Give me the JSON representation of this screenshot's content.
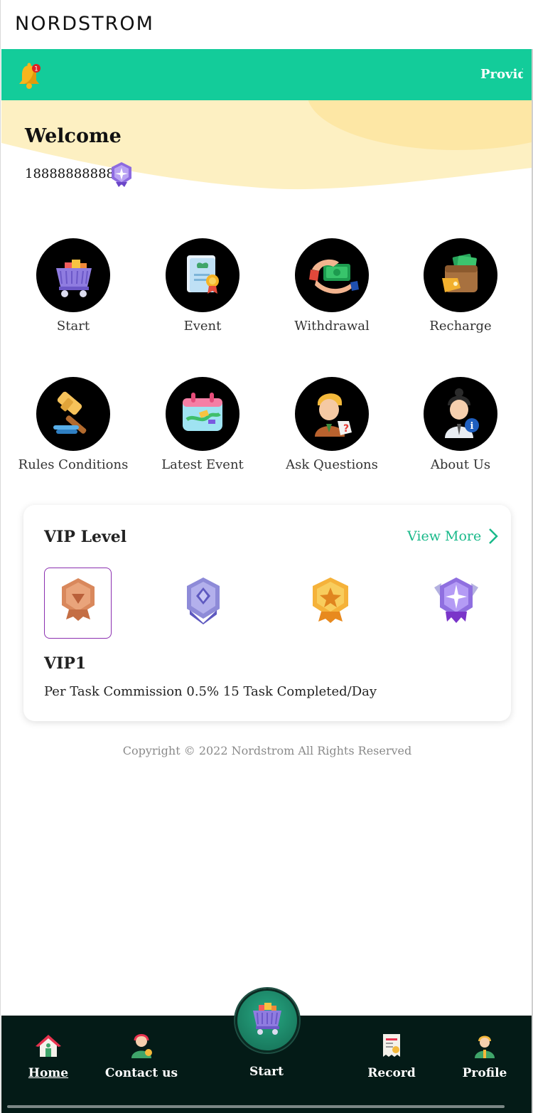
{
  "brand": "NORDSTROM",
  "notice": {
    "text": "Provid",
    "badge_count": "1",
    "bell_icon": "bell-icon",
    "bg_color": "#13cc9a"
  },
  "welcome": {
    "title": "Welcome",
    "phone": "18888888888",
    "vip_icon": "vip-badge-icon"
  },
  "actions": [
    {
      "label": "Start",
      "icon": "shopping-cart-icon"
    },
    {
      "label": "Event",
      "icon": "certificate-icon"
    },
    {
      "label": "Withdrawal",
      "icon": "cash-hand-icon"
    },
    {
      "label": "Recharge",
      "icon": "wallet-icon"
    },
    {
      "label": "Rules Conditions",
      "icon": "gavel-icon"
    },
    {
      "label": "Latest Event",
      "icon": "calendar-icon"
    },
    {
      "label": "Ask Questions",
      "icon": "question-person-icon"
    },
    {
      "label": "About Us",
      "icon": "info-person-icon"
    }
  ],
  "vip": {
    "title": "VIP Level",
    "view_more": "View More",
    "medals": [
      {
        "icon": "bronze-medal-icon",
        "selected": true
      },
      {
        "icon": "silver-medal-icon",
        "selected": false
      },
      {
        "icon": "gold-medal-icon",
        "selected": false
      },
      {
        "icon": "purple-medal-icon",
        "selected": false
      }
    ],
    "selected_name": "VIP1",
    "description": "Per Task Commission 0.5% 15 Task Completed/Day"
  },
  "copyright": "Copyright © 2022 Nordstrom All Rights Reserved",
  "bottom_nav": {
    "home": "Home",
    "contact": "Contact us",
    "start": "Start",
    "record": "Record",
    "profile": "Profile",
    "active": "Home",
    "bg_color": "#041b17"
  }
}
